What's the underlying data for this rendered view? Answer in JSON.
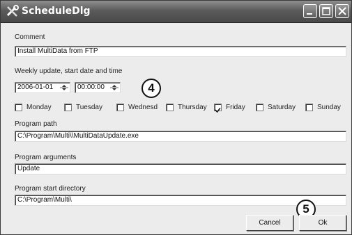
{
  "window": {
    "title": "ScheduleDlg"
  },
  "comment": {
    "label": "Comment",
    "value": "Install MultiData from FTP"
  },
  "schedule": {
    "label": "Weekly update, start date and time",
    "date": "2006-01-01",
    "time": "00:00:00"
  },
  "days": [
    {
      "label": "Monday",
      "checked": false
    },
    {
      "label": "Tuesday",
      "checked": false
    },
    {
      "label": "Wednesd",
      "checked": false
    },
    {
      "label": "Thursday",
      "checked": false
    },
    {
      "label": "Friday",
      "checked": true
    },
    {
      "label": "Saturday",
      "checked": false
    },
    {
      "label": "Sunday",
      "checked": false
    }
  ],
  "program_path": {
    "label": "Program path",
    "value": "C:\\Program\\Multi\\\\MultiDataUpdate.exe"
  },
  "program_args": {
    "label": "Program arguments",
    "value": "Update"
  },
  "program_dir": {
    "label": "Program start directory",
    "value": "C:\\Program\\Multi\\"
  },
  "buttons": {
    "cancel": "Cancel",
    "ok": "Ok"
  },
  "annotations": {
    "a": "4",
    "b": "5"
  }
}
